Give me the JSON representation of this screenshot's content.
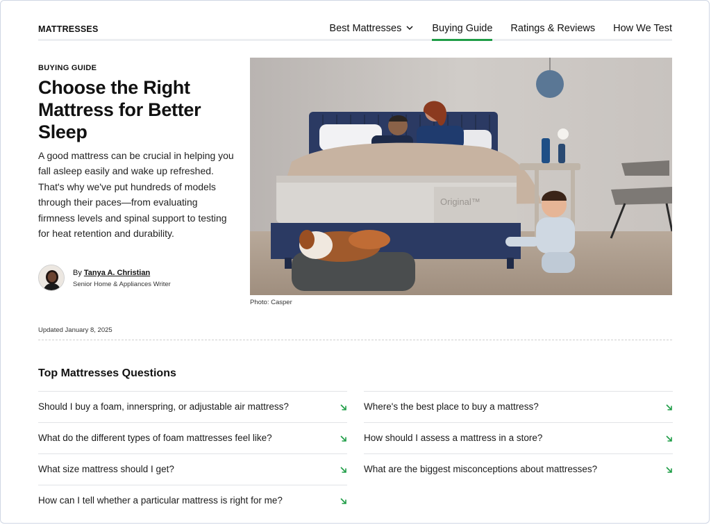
{
  "nav": {
    "brand": "MATTRESSES",
    "links": [
      "Best Mattresses",
      "Buying Guide",
      "Ratings & Reviews",
      "How We Test"
    ],
    "active": "Buying Guide"
  },
  "article": {
    "eyebrow": "BUYING GUIDE",
    "headline": "Choose the Right Mattress for Better Sleep",
    "intro": "A good mattress can be crucial in helping you fall asleep easily and wake up refreshed. That's why we've put hundreds of models through their paces—from evaluating firmness levels and spinal support to testing for heat retention and durability.",
    "author": {
      "by": "By",
      "name": "Tanya A. Christian",
      "role": "Senior Home & Appliances Writer"
    },
    "photo_caption": "Photo: Casper",
    "mattress_label": "Original™",
    "updated": "Updated January 8, 2025"
  },
  "questions": {
    "title": "Top Mattresses Questions",
    "left": [
      "Should I buy a foam, innerspring, or adjustable air mattress?",
      "What do the different types of foam mattresses feel like?",
      "What size mattress should I get?",
      "How can I tell whether a particular mattress is right for me?"
    ],
    "right": [
      "Where's the best place to buy a mattress?",
      "How should I assess a mattress in a store?",
      "What are the biggest misconceptions about mattresses?"
    ]
  },
  "colors": {
    "accent": "#1f9d47",
    "text": "#111111",
    "divider": "#e1e3e6"
  },
  "icons": {
    "nav_dropdown": "chevron-down-icon",
    "question_link": "arrow-down-right-icon"
  }
}
